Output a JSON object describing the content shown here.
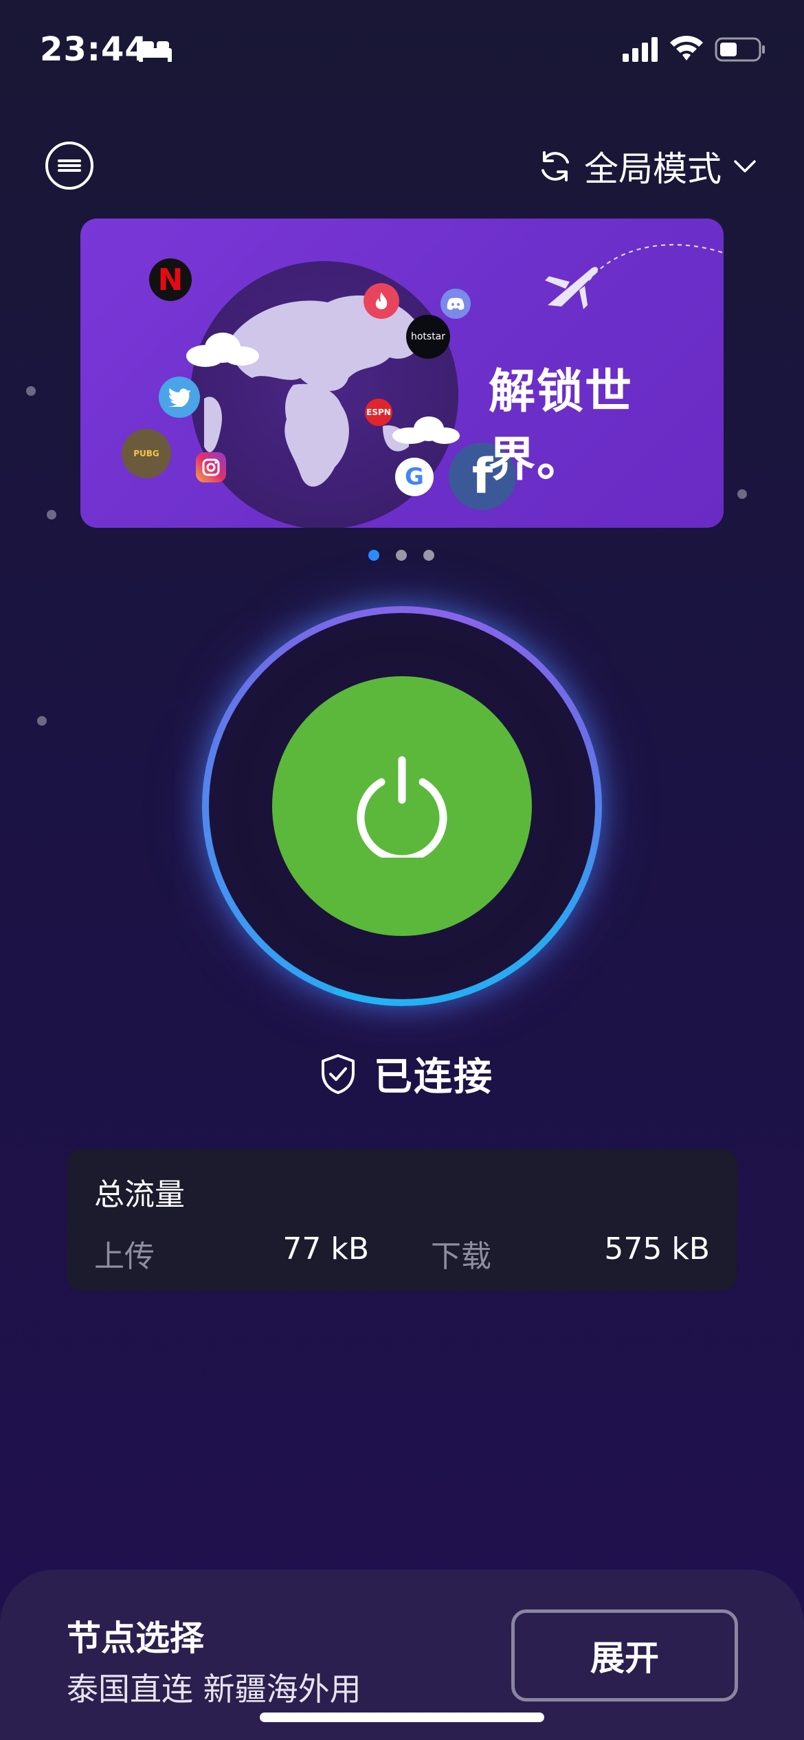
{
  "status_bar": {
    "time": "23:44",
    "icons": [
      "bed-icon",
      "signal-icon",
      "wifi-icon",
      "battery-icon"
    ]
  },
  "header": {
    "menu_icon": "menu-icon",
    "mode_icon": "refresh-icon",
    "mode_label": "全局模式",
    "mode_chevron": "chevron-down-icon"
  },
  "banner": {
    "title": "解锁世界。",
    "app_logos": [
      "netflix-logo",
      "twitter-logo",
      "pubg-logo",
      "instagram-logo",
      "tinder-logo",
      "discord-logo",
      "hotstar-logo",
      "espn-logo",
      "google-logo",
      "facebook-logo"
    ],
    "hotstar_text": "hotstar",
    "espn_text": "ESPN",
    "page_count": 3,
    "active_page": 1,
    "colors": {
      "background": "#7a37d8",
      "globe": "#3d1f6f"
    }
  },
  "power": {
    "state": "connected",
    "colors": {
      "button": "#5cb83b",
      "ring_start": "#2ba7f2",
      "ring_end": "#8a64ea"
    }
  },
  "status": {
    "icon": "shield-check-icon",
    "text": "已连接"
  },
  "traffic": {
    "title": "总流量",
    "upload_label": "上传",
    "upload_value": "77 kB",
    "download_label": "下载",
    "download_value": "575 kB"
  },
  "node": {
    "title": "节点选择",
    "selected": "泰国直连 新疆海外用",
    "expand_label": "展开"
  }
}
